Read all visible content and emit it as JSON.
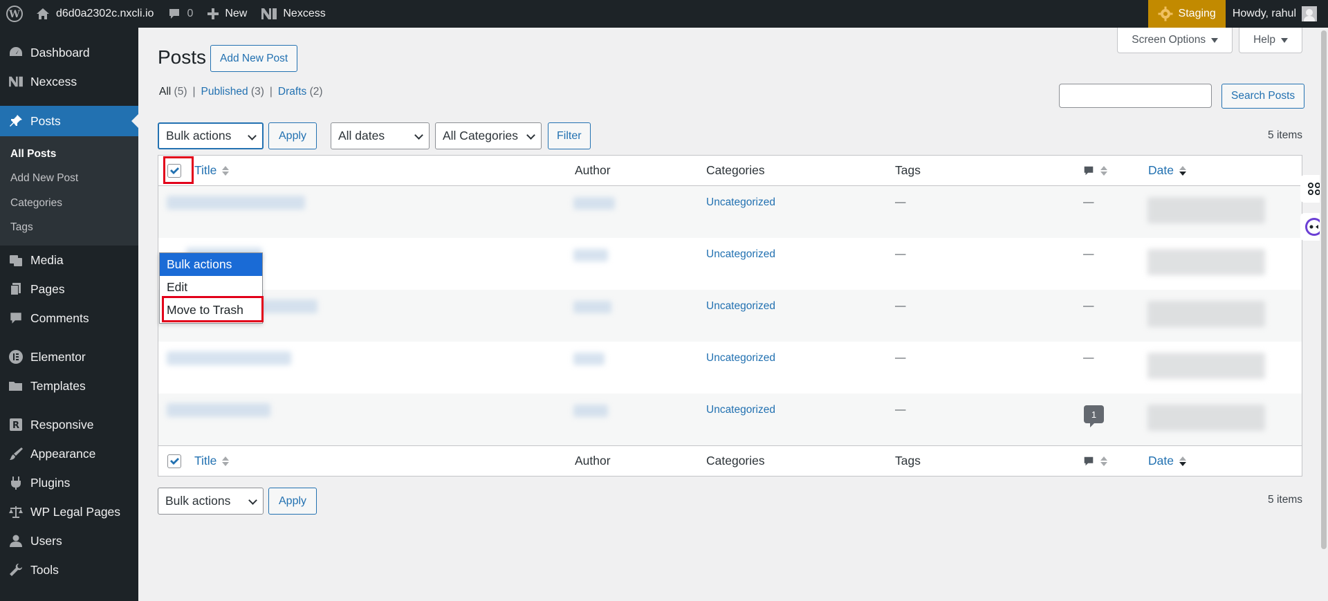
{
  "adminbar": {
    "site_name": "d6d0a2302c.nxcli.io",
    "comments_count": "0",
    "new_label": "New",
    "nexcess_label": "Nexcess",
    "staging_label": "Staging",
    "howdy": "Howdy, rahul"
  },
  "sidebar": {
    "items": [
      {
        "label": "Dashboard",
        "icon": "dashboard-icon"
      },
      {
        "label": "Nexcess",
        "icon": "nexcess-icon"
      },
      {
        "label": "Posts",
        "icon": "pin-icon"
      },
      {
        "label": "Media",
        "icon": "media-icon"
      },
      {
        "label": "Pages",
        "icon": "pages-icon"
      },
      {
        "label": "Comments",
        "icon": "comment-icon"
      },
      {
        "label": "Elementor",
        "icon": "elementor-icon"
      },
      {
        "label": "Templates",
        "icon": "folder-icon"
      },
      {
        "label": "Responsive",
        "icon": "responsive-icon"
      },
      {
        "label": "Appearance",
        "icon": "brush-icon"
      },
      {
        "label": "Plugins",
        "icon": "plugin-icon"
      },
      {
        "label": "WP Legal Pages",
        "icon": "scale-icon"
      },
      {
        "label": "Users",
        "icon": "users-icon"
      },
      {
        "label": "Tools",
        "icon": "wrench-icon"
      }
    ],
    "submenu": [
      "All Posts",
      "Add New Post",
      "Categories",
      "Tags"
    ]
  },
  "header": {
    "screen_options": "Screen Options",
    "help": "Help",
    "title": "Posts",
    "add_new": "Add New Post"
  },
  "views": {
    "all": "All",
    "all_count": "(5)",
    "published": "Published",
    "published_count": "(3)",
    "drafts": "Drafts",
    "drafts_count": "(2)",
    "sep": "|"
  },
  "search": {
    "button": "Search Posts",
    "value": ""
  },
  "filters": {
    "bulk": "Bulk actions",
    "apply": "Apply",
    "dates": "All dates",
    "categories": "All Categories",
    "filter": "Filter",
    "items": "5 items"
  },
  "table": {
    "columns": {
      "title": "Title",
      "author": "Author",
      "categories": "Categories",
      "tags": "Tags",
      "date": "Date"
    },
    "rows": [
      {
        "category": "Uncategorized",
        "tags": "—",
        "comments": "—"
      },
      {
        "category": "Uncategorized",
        "tags": "—",
        "comments": "—"
      },
      {
        "category": "Uncategorized",
        "tags": "—",
        "comments": "—"
      },
      {
        "category": "Uncategorized",
        "tags": "—",
        "comments": "—"
      },
      {
        "category": "Uncategorized",
        "tags": "—",
        "comments": "1"
      }
    ]
  },
  "dropdown": {
    "options": [
      "Bulk actions",
      "Edit",
      "Move to Trash"
    ]
  },
  "colors": {
    "admin_bg": "#1d2327",
    "accent": "#2271b1",
    "staging": "#c28a00",
    "highlight": "#e2001a"
  }
}
